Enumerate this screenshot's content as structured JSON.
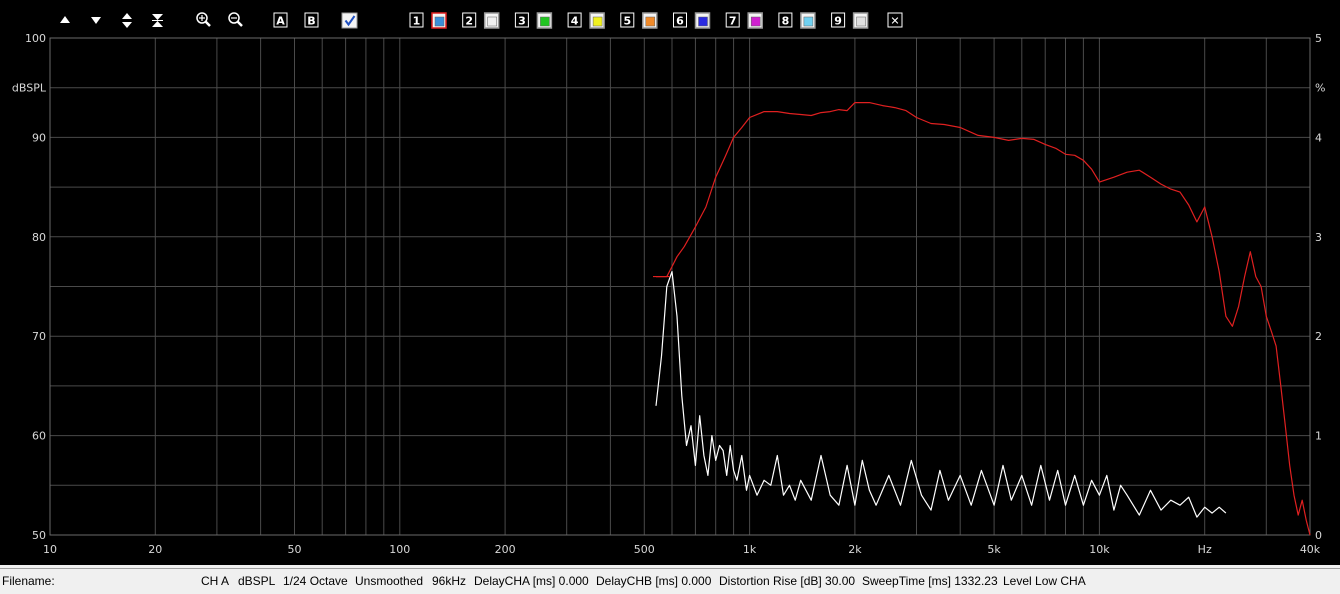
{
  "toolbar": {
    "nav_icons": [
      "arrow-up-icon",
      "arrow-down-icon",
      "expand-vertical-icon",
      "collapse-vertical-icon",
      "zoom-in-icon",
      "zoom-out-icon"
    ],
    "marker_a": "A",
    "marker_b": "B",
    "memory_slots": [
      {
        "label": "1",
        "color": "#3a8fd8",
        "frame": "#e02020"
      },
      {
        "label": "2",
        "color": "#f0f0f0",
        "frame": "#9a9a9a"
      },
      {
        "label": "3",
        "color": "#22c422",
        "frame": "#9a9a9a"
      },
      {
        "label": "4",
        "color": "#f0f020",
        "frame": "#9a9a9a"
      },
      {
        "label": "5",
        "color": "#f08a2a",
        "frame": "#9a9a9a"
      },
      {
        "label": "6",
        "color": "#2a2ae0",
        "frame": "#9a9a9a"
      },
      {
        "label": "7",
        "color": "#d020d0",
        "frame": "#9a9a9a"
      },
      {
        "label": "8",
        "color": "#70d0f0",
        "frame": "#9a9a9a"
      },
      {
        "label": "9",
        "color": "#e0e0e0",
        "frame": "#9a9a9a"
      }
    ],
    "close_label": "✕"
  },
  "status": {
    "filename_label": "Filename:",
    "items": [
      "CH A",
      "dBSPL",
      "1/24 Octave",
      "Unsmoothed",
      "96kHz",
      "DelayCHA [ms] 0.000",
      "DelayCHB [ms] 0.000",
      "Distortion Rise [dB] 30.00",
      "SweepTime [ms] 1332.23",
      "Level Low CHA"
    ]
  },
  "chart_data": {
    "type": "line",
    "title": "",
    "xscale": "log",
    "xlim": [
      10,
      40000
    ],
    "xticks": [
      10,
      20,
      50,
      100,
      200,
      500,
      1000,
      2000,
      5000,
      10000,
      20000,
      40000
    ],
    "xtick_labels": [
      "10",
      "20",
      "50",
      "100",
      "200",
      "500",
      "1k",
      "2k",
      "5k",
      "10k",
      "Hz",
      "40k"
    ],
    "ylim": [
      50,
      100
    ],
    "ylabel": "dBSPL",
    "yticks": [
      50,
      60,
      70,
      80,
      90,
      100
    ],
    "y2label": "%",
    "y2lim": [
      0,
      5
    ],
    "y2ticks": [
      0,
      1,
      2,
      3,
      4,
      5
    ],
    "grid": true,
    "colors": {
      "background": "#000000",
      "grid": "#4a4a4a",
      "frequency_response": "#e02020",
      "distortion": "#ffffff"
    },
    "series": [
      {
        "axis": "left",
        "color": "#e02020",
        "points": [
          [
            540,
            76
          ],
          [
            580,
            76
          ],
          [
            600,
            77
          ],
          [
            620,
            78
          ],
          [
            650,
            79
          ],
          [
            700,
            81
          ],
          [
            750,
            83
          ],
          [
            800,
            86
          ],
          [
            850,
            88
          ],
          [
            900,
            90
          ],
          [
            950,
            91
          ],
          [
            1000,
            92
          ],
          [
            1100,
            92.6
          ],
          [
            1200,
            92.6
          ],
          [
            1300,
            92.4
          ],
          [
            1400,
            92.3
          ],
          [
            1500,
            92.2
          ],
          [
            1600,
            92.5
          ],
          [
            1700,
            92.6
          ],
          [
            1800,
            92.8
          ],
          [
            1900,
            92.7
          ],
          [
            2000,
            93.5
          ],
          [
            2200,
            93.5
          ],
          [
            2400,
            93.2
          ],
          [
            2600,
            93.0
          ],
          [
            2800,
            92.7
          ],
          [
            3000,
            92.0
          ],
          [
            3300,
            91.4
          ],
          [
            3600,
            91.3
          ],
          [
            4000,
            91.0
          ],
          [
            4500,
            90.2
          ],
          [
            5000,
            90.0
          ],
          [
            5500,
            89.7
          ],
          [
            6000,
            89.9
          ],
          [
            6500,
            89.8
          ],
          [
            7000,
            89.3
          ],
          [
            7500,
            88.9
          ],
          [
            8000,
            88.3
          ],
          [
            8500,
            88.2
          ],
          [
            9000,
            87.7
          ],
          [
            9500,
            86.8
          ],
          [
            10000,
            85.5
          ],
          [
            11000,
            86.0
          ],
          [
            12000,
            86.5
          ],
          [
            13000,
            86.7
          ],
          [
            14000,
            86.0
          ],
          [
            15000,
            85.3
          ],
          [
            16000,
            84.8
          ],
          [
            17000,
            84.5
          ],
          [
            18000,
            83.2
          ],
          [
            19000,
            81.5
          ],
          [
            20000,
            83.0
          ],
          [
            21000,
            80.0
          ],
          [
            22000,
            76.5
          ],
          [
            23000,
            72.0
          ],
          [
            24000,
            71.0
          ],
          [
            25000,
            73.0
          ],
          [
            26000,
            76.0
          ],
          [
            27000,
            78.5
          ],
          [
            28000,
            76.0
          ],
          [
            29000,
            75.0
          ],
          [
            30000,
            72.0
          ],
          [
            31000,
            70.5
          ],
          [
            32000,
            69.0
          ],
          [
            33000,
            65.0
          ],
          [
            34000,
            61.0
          ],
          [
            35000,
            57.0
          ],
          [
            36000,
            54.0
          ],
          [
            37000,
            52.0
          ],
          [
            38000,
            53.5
          ],
          [
            39000,
            51.5
          ],
          [
            40000,
            50.0
          ]
        ]
      },
      {
        "axis": "right",
        "color": "#ffffff",
        "points": [
          [
            540,
            1.3
          ],
          [
            560,
            1.8
          ],
          [
            580,
            2.5
          ],
          [
            600,
            2.65
          ],
          [
            620,
            2.2
          ],
          [
            640,
            1.4
          ],
          [
            660,
            0.9
          ],
          [
            680,
            1.1
          ],
          [
            700,
            0.7
          ],
          [
            720,
            1.2
          ],
          [
            740,
            0.8
          ],
          [
            760,
            0.6
          ],
          [
            780,
            1.0
          ],
          [
            800,
            0.75
          ],
          [
            820,
            0.9
          ],
          [
            840,
            0.85
          ],
          [
            860,
            0.6
          ],
          [
            880,
            0.9
          ],
          [
            900,
            0.65
          ],
          [
            920,
            0.55
          ],
          [
            950,
            0.8
          ],
          [
            980,
            0.45
          ],
          [
            1000,
            0.6
          ],
          [
            1050,
            0.4
          ],
          [
            1100,
            0.55
          ],
          [
            1150,
            0.5
          ],
          [
            1200,
            0.8
          ],
          [
            1250,
            0.4
          ],
          [
            1300,
            0.5
          ],
          [
            1350,
            0.35
          ],
          [
            1400,
            0.55
          ],
          [
            1500,
            0.35
          ],
          [
            1600,
            0.8
          ],
          [
            1700,
            0.4
          ],
          [
            1800,
            0.3
          ],
          [
            1900,
            0.7
          ],
          [
            2000,
            0.3
          ],
          [
            2100,
            0.75
          ],
          [
            2200,
            0.45
          ],
          [
            2300,
            0.3
          ],
          [
            2500,
            0.6
          ],
          [
            2700,
            0.3
          ],
          [
            2900,
            0.75
          ],
          [
            3100,
            0.4
          ],
          [
            3300,
            0.25
          ],
          [
            3500,
            0.65
          ],
          [
            3700,
            0.35
          ],
          [
            4000,
            0.6
          ],
          [
            4300,
            0.3
          ],
          [
            4600,
            0.65
          ],
          [
            5000,
            0.3
          ],
          [
            5300,
            0.7
          ],
          [
            5600,
            0.35
          ],
          [
            6000,
            0.6
          ],
          [
            6400,
            0.3
          ],
          [
            6800,
            0.7
          ],
          [
            7200,
            0.35
          ],
          [
            7600,
            0.65
          ],
          [
            8000,
            0.3
          ],
          [
            8500,
            0.6
          ],
          [
            9000,
            0.3
          ],
          [
            9500,
            0.55
          ],
          [
            10000,
            0.4
          ],
          [
            10500,
            0.6
          ],
          [
            11000,
            0.25
          ],
          [
            11500,
            0.5
          ],
          [
            12000,
            0.4
          ],
          [
            13000,
            0.2
          ],
          [
            14000,
            0.45
          ],
          [
            15000,
            0.25
          ],
          [
            16000,
            0.35
          ],
          [
            17000,
            0.3
          ],
          [
            18000,
            0.38
          ],
          [
            19000,
            0.18
          ],
          [
            20000,
            0.28
          ],
          [
            21000,
            0.22
          ],
          [
            22000,
            0.28
          ],
          [
            23000,
            0.22
          ]
        ]
      }
    ]
  }
}
